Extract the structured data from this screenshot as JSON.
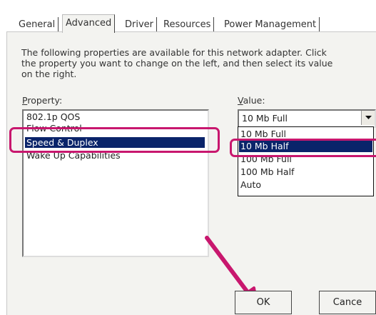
{
  "tabs": [
    {
      "label": "General"
    },
    {
      "label": "Advanced"
    },
    {
      "label": "Driver"
    },
    {
      "label": "Resources"
    },
    {
      "label": "Power Management"
    }
  ],
  "description": "The following properties are available for this network adapter. Click the property you want to change on the left, and then select its value on the right.",
  "property_label": "Property:",
  "property_label_key": "P",
  "property_label_rest": "roperty:",
  "value_label": "Value:",
  "value_label_key": "V",
  "value_label_rest": "alue:",
  "properties": [
    {
      "label": "802.1p QOS"
    },
    {
      "label": "Flow Control"
    },
    {
      "label": "Speed & Duplex"
    },
    {
      "label": "Wake Up Capabilities"
    }
  ],
  "selected_property": "Speed & Duplex",
  "value": {
    "current": "10 Mb Full",
    "options": [
      {
        "label": "10 Mb Full"
      },
      {
        "label": "10 Mb Half"
      },
      {
        "label": "100 Mb Full"
      },
      {
        "label": "100 Mb Half"
      },
      {
        "label": "Auto"
      }
    ],
    "selected_option": "10 Mb Half"
  },
  "buttons": {
    "ok": "OK",
    "cancel": "Cance"
  },
  "colors": {
    "highlight_ring": "#c8176e",
    "selection": "#0a246a"
  },
  "icons": {
    "dropdown": "dropdown-arrow-icon",
    "annotation": "annotation-arrow-icon"
  }
}
